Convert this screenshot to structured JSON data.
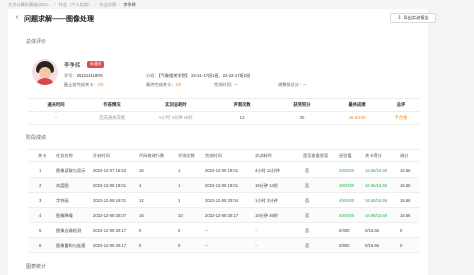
{
  "breadcrumb": [
    "大学计算机基础(2021...",
    "作业（个人实践）",
    "作业详情",
    "李争辉"
  ],
  "header": {
    "back_icon": "‹",
    "title": "问题求解——图像处理",
    "export_label": "导出实训报告"
  },
  "overview": {
    "section_title": "总体评价",
    "student": {
      "name": "李争辉",
      "status": "未通关",
      "student_id_label": "学号：",
      "student_id": "2022141180'6",
      "class_label": "分班：",
      "class_value": "【气象相关学院】 22-21-17班1班、22-22-17班2班",
      "levels_label": "截止前完成关卡：",
      "levels_value": "4/6",
      "latest_submit_label": "最终完成关卡：",
      "latest_submit_value": "4/6",
      "time_label": "完成时间：",
      "time_value": "--",
      "teacher_adjust_label": "调整前总分：",
      "teacher_adjust_value": "--"
    }
  },
  "stats": {
    "headers": [
      "通关时间",
      "作答情况",
      "实训总耗时",
      "评测次数",
      "获奖积分",
      "最终成绩",
      "总评"
    ],
    "values": [
      "--",
      "完成通关前缀",
      "5小时 2分钟 29秒",
      "13",
      "30",
      "26.6/100",
      "不合格"
    ]
  },
  "stages": {
    "section_title": "阶段成绩",
    "columns": [
      "关卡",
      "任务名称",
      "开启时间",
      "代码修改行数",
      "评测次数",
      "完成时间",
      "实训耗时",
      "是否查看答案",
      "经验值",
      "关卡得分",
      "调分"
    ],
    "rows": [
      [
        "1",
        "图像读取与显示",
        "2022-12-07 15:53",
        "15",
        "1",
        "2022-12-08 19:01",
        "4小时 11分钟",
        "否",
        "200/200",
        "16.66/16.66",
        "16.66"
      ],
      [
        "2",
        "灰度图",
        "2022-12-08 19:01",
        "4",
        "1",
        "2022-12-08 19:01",
        "16分钟 14秒",
        "否",
        "400/400",
        "16.66/16.66",
        "16.66"
      ],
      [
        "3",
        "字符画",
        "2022-12-08 19:01",
        "12",
        "1",
        "2022-12-08 20:04",
        "1小时 3分钟",
        "否",
        "400/400",
        "16.66/16.66",
        "16.66"
      ],
      [
        "4",
        "图像降噪",
        "2022-12-08 20:07",
        "16",
        "10",
        "2022-12-08 20:17",
        "10分钟 46秒",
        "否",
        "400/400",
        "16.66/16.66",
        "16.66"
      ],
      [
        "5",
        "图像边缘检测",
        "2022-12-08 20:17",
        "0",
        "0",
        "--",
        "--",
        "否",
        "0/400",
        "0/16.66",
        "0"
      ],
      [
        "6",
        "图像重构与处理",
        "2022-12-08 20:17",
        "0",
        "0",
        "--",
        "--",
        "否",
        "0/800",
        "0/16.66",
        "0"
      ]
    ]
  },
  "footer": {
    "section_title": "图表统计"
  },
  "colors": {
    "accent": "#f08a24",
    "badge": "#e24c4c",
    "success": "#2bb24c"
  },
  "icons": {
    "back": "chevron-left-icon",
    "export": "download-icon"
  }
}
